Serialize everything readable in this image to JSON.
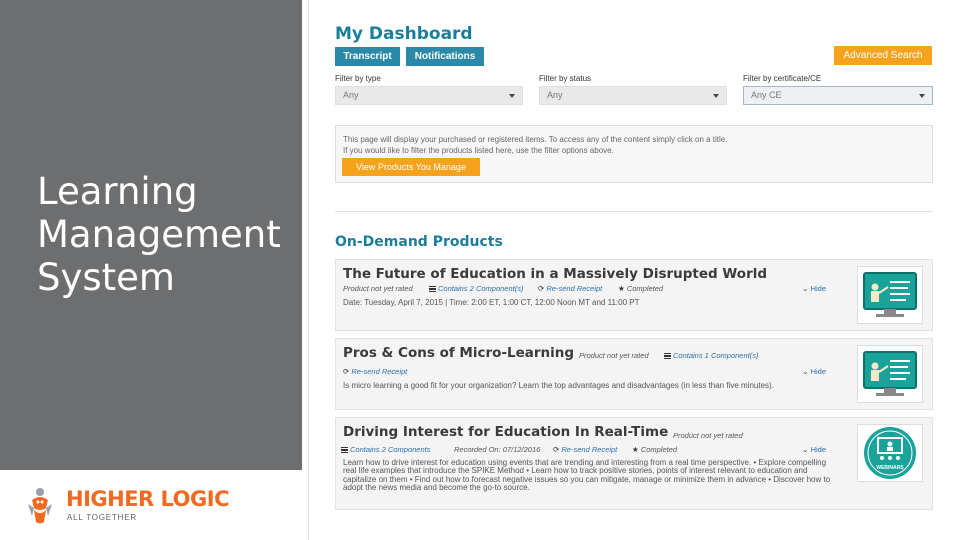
{
  "slide": {
    "title_lines": [
      "Learning",
      "Management",
      "System"
    ],
    "logo_text": "HIGHER LOGIC",
    "logo_tagline": "ALL TOGETHER"
  },
  "dashboard": {
    "title": "My Dashboard",
    "tabs": [
      "Transcript",
      "Notifications"
    ],
    "advanced_search": "Advanced Search",
    "filters": [
      {
        "label": "Filter by type",
        "value": "Any"
      },
      {
        "label": "Filter by status",
        "value": "Any"
      },
      {
        "label": "Filter by certificate/CE",
        "value": "Any CE"
      }
    ],
    "info_lines": [
      "This page will display your purchased or registered items. To access any of the content simply click on a title.",
      "If you would like to filter the products listed here, use the filter options above."
    ],
    "view_products_button": "View Products You Manage",
    "section_title": "On-Demand Products"
  },
  "products": [
    {
      "title": "The Future of Education in a Massively Disrupted World",
      "rating": "Product not yet rated",
      "components": "Contains 2 Component(s)",
      "receipt": "Re-send Receipt",
      "status": "Completed",
      "description": "Date: Tuesday, April 7, 2015 | Time: 2:00 ET, 1:00 CT, 12:00 Noon MT and 11:00 PT",
      "hide": "Hide",
      "thumb_icon": "presenter-monitor-icon"
    },
    {
      "title": "Pros & Cons of Micro-Learning",
      "rating": "Product not yet rated",
      "components": "Contains 1 Component(s)",
      "receipt": "Re-send Receipt",
      "description": "Is micro learning a good fit for your organization? Learn the top advantages and disadvantages (in less than five minutes).",
      "hide": "Hide",
      "thumb_icon": "presenter-monitor-icon"
    },
    {
      "title": "Driving Interest for Education In Real-Time",
      "rating": "Product not yet rated",
      "components": "Contains 2 Components",
      "recorded": "Recorded On: 07/12/2016",
      "receipt": "Re-send Receipt",
      "status": "Completed",
      "description": "Learn how to drive interest for education using events that are trending and interesting from a real time perspective. • Explore compelling real life examples that introduce the SPIKE Method • Learn how to track positive stories, points of interest relevant to education and capitalize on them • Find out how to forecast negative issues so you can mitigate, manage or minimize them in advance • Discover how to adopt the news media and become the go-to source.",
      "hide": "Hide",
      "thumb_icon": "webinar-badge-icon",
      "thumb_text": "WEBINARS"
    }
  ],
  "colors": {
    "left_panel": "#6d6e70",
    "teal": "#1c7e9a",
    "tab_blue": "#2a89a8",
    "orange": "#f5a31d",
    "logo_orange": "#f26a21",
    "monitor_green": "#1aa39a"
  }
}
